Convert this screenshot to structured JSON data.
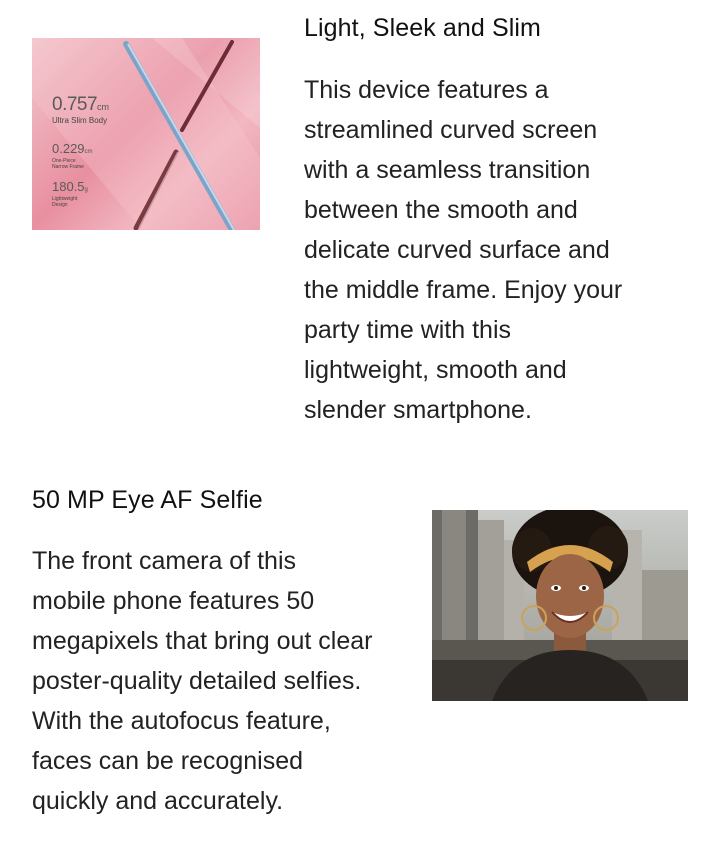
{
  "feature_1": {
    "title": "Light, Sleek and Slim",
    "body_lines": [
      "This device features a",
      "streamlined curved screen",
      "with a seamless transition",
      "between the smooth and",
      "delicate curved surface and",
      "the middle frame. Enjoy your",
      "party time with this",
      "lightweight, smooth and",
      "slender smartphone."
    ],
    "image": {
      "spec_1_value": "0.757",
      "spec_1_unit": "cm",
      "spec_1_label": "Ultra Slim Body",
      "spec_2_value": "0.229",
      "spec_2_unit": "cm",
      "spec_2_label": "One-Piece Narrow Frame",
      "spec_3_value": "180.5",
      "spec_3_unit": "g",
      "spec_3_label": "Lightweight Design"
    }
  },
  "feature_2": {
    "title": "50 MP Eye AF Selfie",
    "body_lines": [
      "The front camera of this",
      "mobile phone features 50",
      "megapixels that bring out clear",
      "poster-quality detailed selfies.",
      "With the autofocus feature,",
      "faces can be recognised",
      "quickly and accurately."
    ]
  }
}
